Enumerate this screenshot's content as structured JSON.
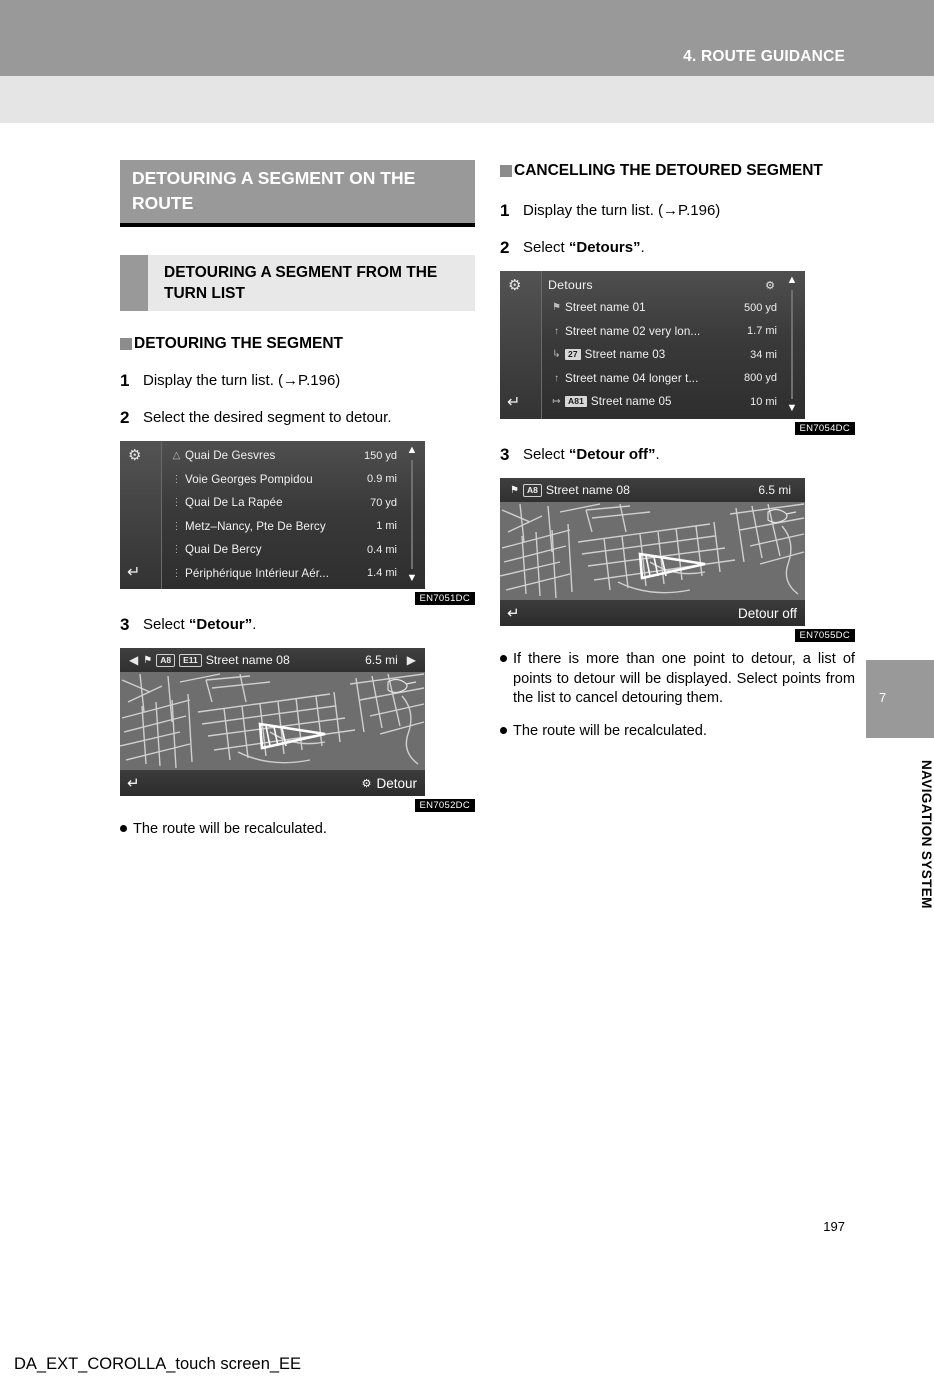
{
  "header": {
    "chapter_title": "4. ROUTE GUIDANCE"
  },
  "side_tab": {
    "number": "7",
    "label": "NAVIGATION SYSTEM"
  },
  "footer": {
    "page_number": "197",
    "document_id": "DA_EXT_COROLLA_touch screen_EE"
  },
  "left_column": {
    "section_title": "DETOURING A SEGMENT ON THE ROUTE",
    "sub_heading": "DETOURING A SEGMENT FROM THE TURN LIST",
    "topic_heading": "DETOURING THE SEGMENT",
    "steps": [
      {
        "num": "1",
        "text": "Display the turn list. (→P.196)"
      },
      {
        "num": "2",
        "text": "Select the desired segment to detour."
      },
      {
        "num": "3",
        "text_before": "Select ",
        "bold": "“Detour”",
        "text_after": "."
      }
    ],
    "bullets": [
      "The route will be recalculated."
    ],
    "turn_list_screen": {
      "code": "EN7051DC",
      "gear_icon": "gear-icon",
      "back_icon": "back-arrow-icon",
      "scroll_up": "▲",
      "scroll_down": "▼",
      "rows": [
        {
          "name": "Quai De Gesvres",
          "distance": "150 yd"
        },
        {
          "name": "Voie Georges Pompidou",
          "distance": "0.9 mi"
        },
        {
          "name": "Quai De La Rapée",
          "distance": "70 yd"
        },
        {
          "name": "Metz–Nancy, Pte De Bercy",
          "distance": "1 mi"
        },
        {
          "name": "Quai De Bercy",
          "distance": "0.4 mi"
        },
        {
          "name": "Périphérique Intérieur Aér...",
          "distance": "1.4 mi"
        }
      ]
    },
    "detour_map_screen": {
      "code": "EN7052DC",
      "prev_arrow": "◀",
      "next_arrow": "▶",
      "badges": [
        "A8",
        "E11"
      ],
      "street": "Street name 08",
      "distance": "6.5 mi",
      "back_icon": "back-arrow-icon",
      "button_label": "Detour"
    }
  },
  "right_column": {
    "topic_heading": "CANCELLING THE DETOURED SEGMENT",
    "steps": [
      {
        "num": "1",
        "text": "Display the turn list. (→P.196)"
      },
      {
        "num": "2",
        "text_before": "Select ",
        "bold": "“Detours”",
        "text_after": "."
      },
      {
        "num": "3",
        "text_before": "Select ",
        "bold": "“Detour off”",
        "text_after": "."
      }
    ],
    "bullets": [
      "If there is more than one point to detour, a list of points to detour will be displayed. Select points from the list to cancel detouring them.",
      "The route will be recalculated."
    ],
    "detours_list_screen": {
      "code": "EN7054DC",
      "title": "Detours",
      "gear_icon": "gear-icon",
      "back_icon": "back-arrow-icon",
      "detour_icon": "detour-icon",
      "scroll_up": "▲",
      "scroll_down": "▼",
      "rows": [
        {
          "badge": "",
          "name": "Street name 01",
          "distance": "500 yd"
        },
        {
          "badge": "",
          "name": "Street name 02 very lon...",
          "distance": "1.7 mi"
        },
        {
          "badge": "27",
          "name": "Street name 03",
          "distance": "34 mi"
        },
        {
          "badge": "",
          "name": "Street name 04 longer t...",
          "distance": "800 yd"
        },
        {
          "badge": "A81",
          "name": "Street name 05",
          "distance": "10 mi"
        }
      ]
    },
    "detour_off_map_screen": {
      "code": "EN7055DC",
      "badges": [
        "A8"
      ],
      "street": "Street name 08",
      "distance": "6.5 mi",
      "back_icon": "back-arrow-icon",
      "button_label": "Detour off"
    }
  },
  "colors": {
    "header_gray": "#999999",
    "header_light": "#e5e5e5",
    "subhead_bg": "#e8e8e8",
    "swatch": "#999999",
    "screen_dark": "#3a3a3a"
  }
}
